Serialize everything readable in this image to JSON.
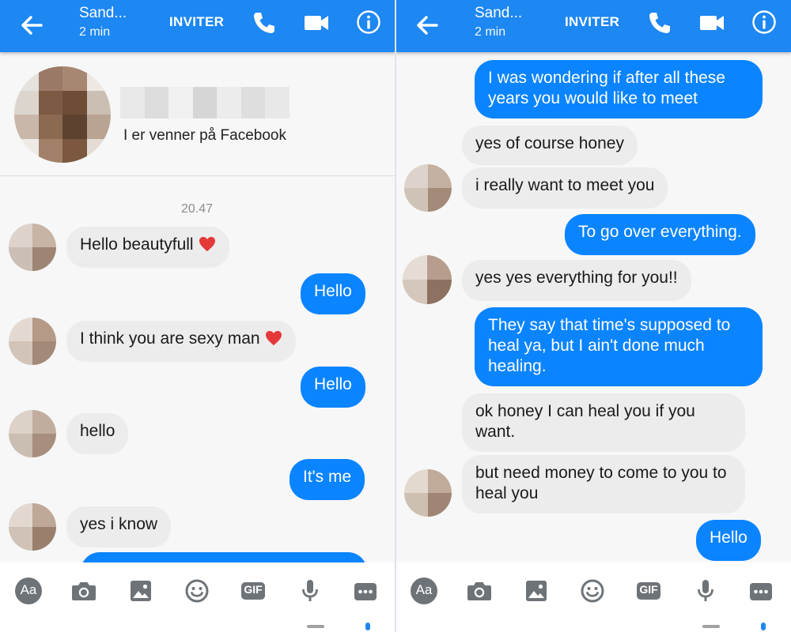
{
  "colors": {
    "header_blue": "#1d87f2",
    "outgoing_bubble": "#0a84ff",
    "incoming_bubble": "#ececec",
    "heart": "#e53838"
  },
  "screens": [
    {
      "header": {
        "title": "Sand...",
        "subtitle": "2 min",
        "invite": "INVITER",
        "icons": [
          "back-arrow-icon",
          "phone-icon",
          "video-camera-icon",
          "info-icon"
        ]
      },
      "profile": {
        "friends_text": "I er venner på Facebook"
      },
      "timestamp": "20.47",
      "messages": [
        {
          "dir": "in",
          "text": "Hello beautyfull",
          "emoji": "heart"
        },
        {
          "dir": "out",
          "text": "Hello"
        },
        {
          "dir": "in",
          "text": "I think you are sexy man",
          "emoji": "heart"
        },
        {
          "dir": "out",
          "text": "Hello"
        },
        {
          "dir": "in",
          "text": "hello"
        },
        {
          "dir": "out",
          "text": "It's me"
        },
        {
          "dir": "in",
          "text": "yes i know"
        }
      ],
      "composer_icons": [
        "text-format-icon",
        "camera-icon",
        "image-icon",
        "emoji-icon",
        "gif-icon",
        "microphone-icon",
        "more-icon"
      ],
      "composer_labels": {
        "text_format": "Aa",
        "gif": "GIF"
      }
    },
    {
      "header": {
        "title": "Sand...",
        "subtitle": "2 min",
        "invite": "INVITER",
        "icons": [
          "back-arrow-icon",
          "phone-icon",
          "video-camera-icon",
          "info-icon"
        ]
      },
      "messages": [
        {
          "dir": "out",
          "text": "I was wondering if after all these years you would like to meet"
        },
        {
          "dir": "in",
          "text": "yes of course honey"
        },
        {
          "dir": "in",
          "text": "i really want to meet you"
        },
        {
          "dir": "out",
          "text": "To go over everything."
        },
        {
          "dir": "in",
          "text": "yes yes everything for you!!"
        },
        {
          "dir": "out",
          "text": "They say that time's supposed to heal ya, but I ain't done much healing."
        },
        {
          "dir": "in",
          "text": "ok honey I can heal you if you want."
        },
        {
          "dir": "in",
          "text": "but need money to come to you to heal you"
        },
        {
          "dir": "out",
          "text": "Hello"
        }
      ],
      "composer_icons": [
        "text-format-icon",
        "camera-icon",
        "image-icon",
        "emoji-icon",
        "gif-icon",
        "microphone-icon",
        "more-icon"
      ],
      "composer_labels": {
        "text_format": "Aa",
        "gif": "GIF"
      }
    }
  ]
}
